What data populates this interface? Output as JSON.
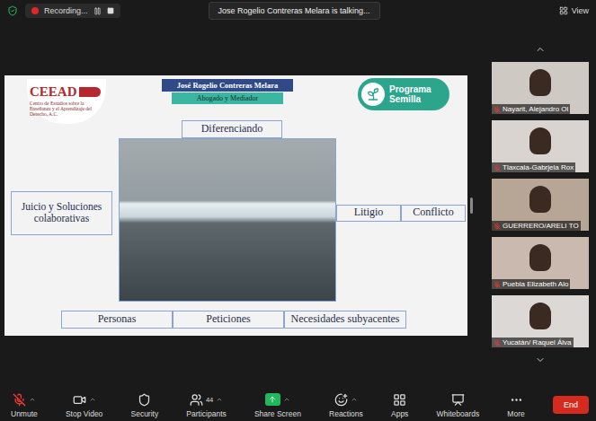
{
  "top_bar": {
    "recording": "Recording...",
    "talking": "Jose Rogelio Contreras Melara is talking...",
    "view": "View"
  },
  "slide": {
    "logo": {
      "short": "CEEAD",
      "full": "Centro de Estudios sobre la Enseñanza y el Aprendizaje del Derecho, A.C."
    },
    "speaker": {
      "name": "José Rogelio Contreras Melara",
      "role": "Abogado y Mediador"
    },
    "program": "Programa Semilla",
    "heading": "Diferenciando",
    "left": "Juicio y Soluciones colaborativas",
    "right": [
      "Litigio",
      "Conflicto"
    ],
    "bottom": [
      "Personas",
      "Peticiones",
      "Necesidades subyacentes"
    ]
  },
  "participants": [
    {
      "name": "Nayarit, Alejandro Ol",
      "muted": true,
      "color": "#cfc9c4"
    },
    {
      "name": "Tlaxcala-Gabrjela Rox",
      "muted": true,
      "color": "#d9d4cf"
    },
    {
      "name": "GUERRERO/ARELI TO",
      "muted": true,
      "color": "#b7a596"
    },
    {
      "name": "Puebla Elizabeth Alo",
      "muted": true,
      "color": "#c9b9ae"
    },
    {
      "name": "Yucatán/ Raquel Álva",
      "muted": true,
      "color": "#dcd8d5"
    }
  ],
  "toolbar": [
    {
      "label": "Unmute",
      "kind": "button",
      "has_menu": true,
      "muted": true
    },
    {
      "label": "Stop Video",
      "kind": "button",
      "has_menu": true
    },
    {
      "label": "Security",
      "kind": "button",
      "has_menu": false
    },
    {
      "label": "Participants",
      "kind": "button",
      "has_menu": true,
      "count": "44"
    },
    {
      "label": "Share Screen",
      "kind": "share",
      "has_menu": true
    },
    {
      "label": "Reactions",
      "kind": "button",
      "has_menu": true
    },
    {
      "label": "Apps",
      "kind": "button",
      "has_menu": false
    },
    {
      "label": "Whiteboards",
      "kind": "button",
      "has_menu": false
    },
    {
      "label": "More",
      "kind": "button",
      "has_menu": false
    }
  ],
  "end": "End"
}
